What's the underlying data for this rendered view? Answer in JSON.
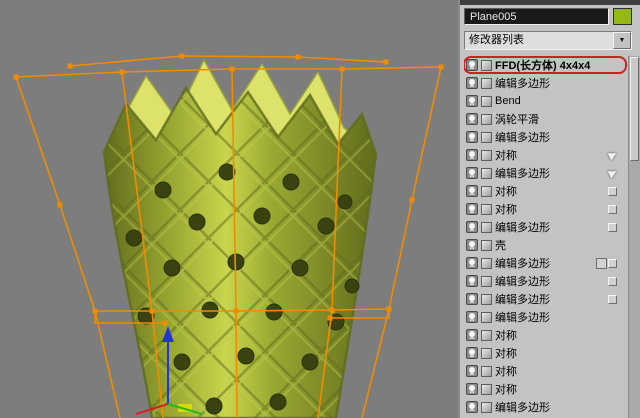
{
  "panel": {
    "object_name": "Plane005",
    "object_color": "#93b818",
    "modifier_dropdown": {
      "label": "修改器列表",
      "arrow_icon": "▼"
    },
    "stack": [
      {
        "label": "FFD(长方体) 4x4x4",
        "selected": true,
        "right_icon": null
      },
      {
        "label": "编辑多边形",
        "selected": false,
        "right_icon": null
      },
      {
        "label": "Bend",
        "selected": false,
        "right_icon": null
      },
      {
        "label": "涡轮平滑",
        "selected": false,
        "right_icon": null
      },
      {
        "label": "编辑多边形",
        "selected": false,
        "right_icon": null
      },
      {
        "label": "对称",
        "selected": false,
        "right_icon": "arrow"
      },
      {
        "label": "编辑多边形",
        "selected": false,
        "right_icon": "arrow"
      },
      {
        "label": "对称",
        "selected": false,
        "right_icon": "square"
      },
      {
        "label": "对称",
        "selected": false,
        "right_icon": "square"
      },
      {
        "label": "编辑多边形",
        "selected": false,
        "right_icon": "square"
      },
      {
        "label": "壳",
        "selected": false,
        "right_icon": null
      },
      {
        "label": "编辑多边形",
        "selected": false,
        "right_icon": "square-double"
      },
      {
        "label": "编辑多边形",
        "selected": false,
        "right_icon": "square"
      },
      {
        "label": "编辑多边形",
        "selected": false,
        "right_icon": "square"
      },
      {
        "label": "编辑多边形",
        "selected": false,
        "right_icon": null
      },
      {
        "label": "对称",
        "selected": false,
        "right_icon": null
      },
      {
        "label": "对称",
        "selected": false,
        "right_icon": null
      },
      {
        "label": "对称",
        "selected": false,
        "right_icon": null
      },
      {
        "label": "对称",
        "selected": false,
        "right_icon": null
      },
      {
        "label": "编辑多边形",
        "selected": false,
        "right_icon": null
      }
    ]
  },
  "viewport": {
    "colors": {
      "background": "#7d7d7d",
      "ffd_lattice": "#f08c00",
      "vase_dark_edge": "#626c1c",
      "vase_mid": "#9aa832",
      "vase_highlight": "#c9d54c",
      "lattice_groove": "#5f6a1b",
      "lattice_ridge": "#c2cd52",
      "hole": "#3a430f",
      "petal_back": "#dce26a",
      "gizmo_z": "#2335d8",
      "gizmo_x": "#d62222",
      "gizmo_y": "#22bb22",
      "gizmo_plane": "#dede00"
    }
  }
}
